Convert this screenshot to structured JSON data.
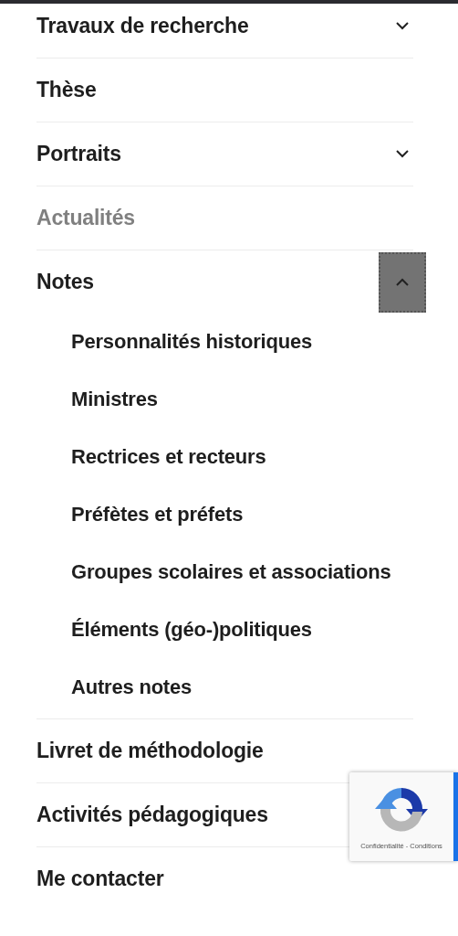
{
  "menu": [
    {
      "label": "Travaux de recherche",
      "selected": false,
      "expanded": false
    },
    {
      "label": "Thèse",
      "selected": false
    },
    {
      "label": "Portraits",
      "selected": false,
      "expanded": false
    },
    {
      "label": "Actualités",
      "selected": true
    },
    {
      "label": "Notes",
      "selected": false,
      "expanded": true,
      "children": [
        {
          "label": "Personnalités historiques",
          "selected": false
        },
        {
          "label": "Ministres",
          "selected": false
        },
        {
          "label": "Rectrices et recteurs",
          "selected": false
        },
        {
          "label": "Préfètes et préfets",
          "selected": false
        },
        {
          "label": "Groupes scolaires et associations",
          "selected": false
        },
        {
          "label": "Éléments (géo-)politiques",
          "selected": false
        },
        {
          "label": "Autres notes",
          "selected": false
        }
      ]
    },
    {
      "label": "Livret de méthodologie",
      "selected": false
    },
    {
      "label": "Activités pédagogiques",
      "selected": false
    },
    {
      "label": "Me contacter",
      "selected": false
    }
  ],
  "recaptcha": {
    "links": "Confidentialité - Conditions"
  }
}
